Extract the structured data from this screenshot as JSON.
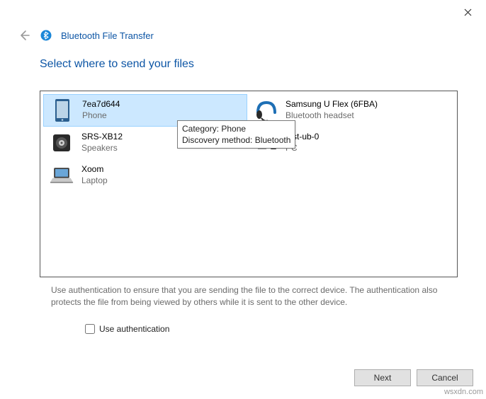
{
  "window": {
    "title": "Bluetooth File Transfer",
    "heading": "Select where to send your files"
  },
  "devices": [
    {
      "name": "7ea7d644",
      "type": "Phone"
    },
    {
      "name": "Samsung U Flex (6FBA)",
      "type": "Bluetooth headset"
    },
    {
      "name": "SRS-XB12",
      "type": "Speakers"
    },
    {
      "name": "test-ub-0",
      "type": "PC"
    },
    {
      "name": "Xoom",
      "type": "Laptop"
    }
  ],
  "tooltip": {
    "line1": "Category: Phone",
    "line2": "Discovery method: Bluetooth"
  },
  "hint": "Use authentication to ensure that you are sending the file to the correct device. The authentication also protects the file from being viewed by others while it is sent to the other device.",
  "auth_label": "Use authentication",
  "buttons": {
    "next": "Next",
    "cancel": "Cancel"
  },
  "watermark": "wsxdn.com"
}
